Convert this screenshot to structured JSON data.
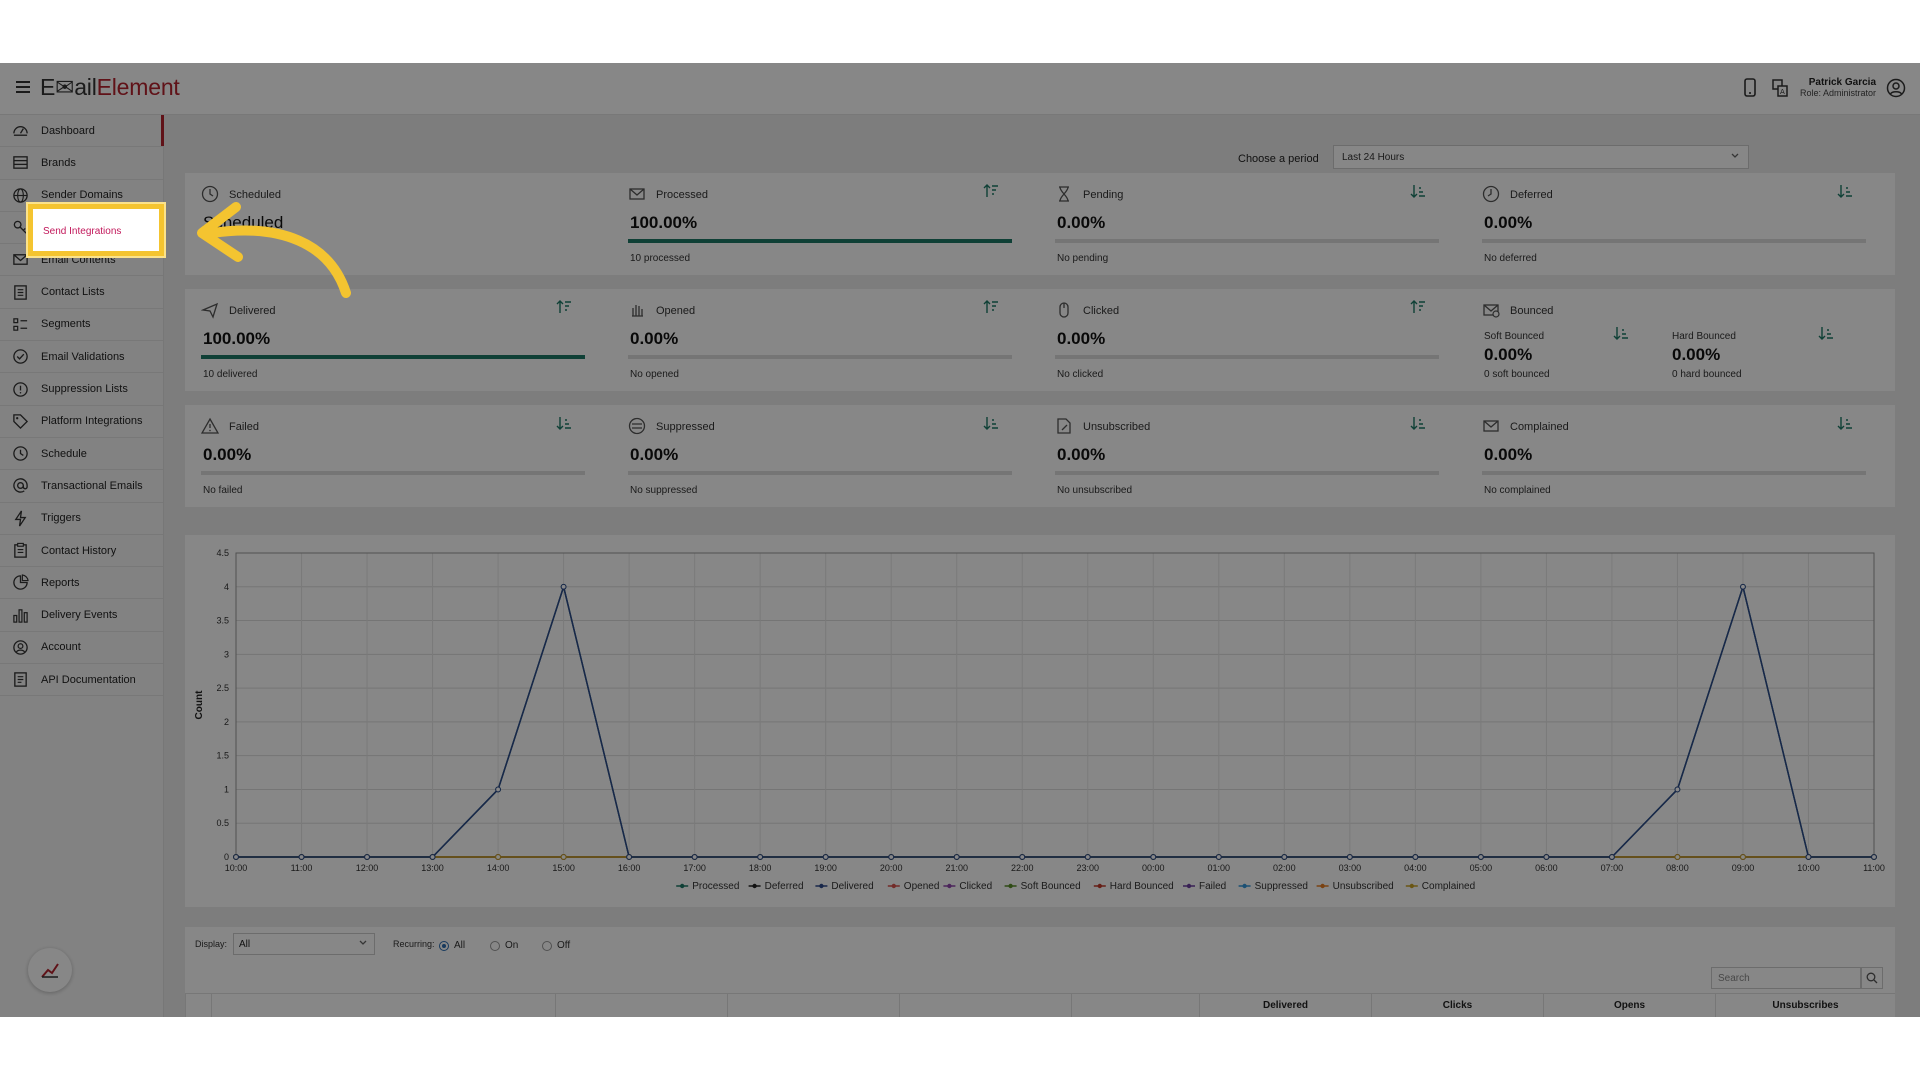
{
  "app": {
    "logo_left": "E✉ail",
    "logo_right": "Element",
    "user_name": "Patrick Garcia",
    "user_role": "Role: Administrator"
  },
  "sidebar": {
    "items": [
      {
        "label": "Dashboard",
        "icon": "dashboard-icon"
      },
      {
        "label": "Brands",
        "icon": "brands-icon"
      },
      {
        "label": "Sender Domains",
        "icon": "globe-icon"
      },
      {
        "label": "Send Integrations",
        "icon": "key-icon"
      },
      {
        "label": "Email Contents",
        "icon": "envelope-icon"
      },
      {
        "label": "Contact Lists",
        "icon": "list-icon"
      },
      {
        "label": "Segments",
        "icon": "segments-icon"
      },
      {
        "label": "Email Validations",
        "icon": "check-circle-icon"
      },
      {
        "label": "Suppression Lists",
        "icon": "alert-circle-icon"
      },
      {
        "label": "Platform Integrations",
        "icon": "tag-icon"
      },
      {
        "label": "Schedule",
        "icon": "clock-icon"
      },
      {
        "label": "Transactional Emails",
        "icon": "at-icon"
      },
      {
        "label": "Triggers",
        "icon": "lightning-icon"
      },
      {
        "label": "Contact History",
        "icon": "clipboard-icon"
      },
      {
        "label": "Reports",
        "icon": "pie-icon"
      },
      {
        "label": "Delivery Events",
        "icon": "bar-chart-icon"
      },
      {
        "label": "Account",
        "icon": "user-circle-icon"
      },
      {
        "label": "API Documentation",
        "icon": "document-icon"
      }
    ]
  },
  "period": {
    "label": "Choose a period",
    "value": "Last 24 Hours"
  },
  "stats": {
    "scheduled": {
      "title": "Scheduled",
      "value": "Scheduled"
    },
    "processed": {
      "title": "Processed",
      "value": "100.00%",
      "sub": "10 processed",
      "fill": 1.0
    },
    "pending": {
      "title": "Pending",
      "value": "0.00%",
      "sub": "No pending",
      "fill": 0
    },
    "deferred": {
      "title": "Deferred",
      "value": "0.00%",
      "sub": "No deferred",
      "fill": 0
    },
    "delivered": {
      "title": "Delivered",
      "value": "100.00%",
      "sub": "10 delivered",
      "fill": 1.0
    },
    "opened": {
      "title": "Opened",
      "value": "0.00%",
      "sub": "No opened",
      "fill": 0
    },
    "clicked": {
      "title": "Clicked",
      "value": "0.00%",
      "sub": "No clicked",
      "fill": 0
    },
    "bounced": {
      "title": "Bounced",
      "soft_title": "Soft Bounced",
      "soft_value": "0.00%",
      "soft_sub": "0 soft bounced",
      "hard_title": "Hard Bounced",
      "hard_value": "0.00%",
      "hard_sub": "0 hard bounced"
    },
    "failed": {
      "title": "Failed",
      "value": "0.00%",
      "sub": "No failed",
      "fill": 0
    },
    "suppressed": {
      "title": "Suppressed",
      "value": "0.00%",
      "sub": "No suppressed",
      "fill": 0
    },
    "unsubscribed": {
      "title": "Unsubscribed",
      "value": "0.00%",
      "sub": "No unsubscribed",
      "fill": 0
    },
    "complained": {
      "title": "Complained",
      "value": "0.00%",
      "sub": "No complained",
      "fill": 0
    }
  },
  "chart_data": {
    "type": "line",
    "x": [
      "10:00",
      "11:00",
      "12:00",
      "13:00",
      "14:00",
      "15:00",
      "16:00",
      "17:00",
      "18:00",
      "19:00",
      "20:00",
      "21:00",
      "22:00",
      "23:00",
      "00:00",
      "01:00",
      "02:00",
      "03:00",
      "04:00",
      "05:00",
      "06:00",
      "07:00",
      "08:00",
      "09:00",
      "10:00",
      "11:00"
    ],
    "ylabel": "Count",
    "xlabel": "",
    "ylim": [
      0,
      4.5
    ],
    "yticks": [
      "0",
      "0.5",
      "1",
      "1.5",
      "2",
      "2.5",
      "3",
      "3.5",
      "4",
      "4.5"
    ],
    "grid": true,
    "legend_position": "bottom",
    "series": [
      {
        "name": "Processed",
        "color": "#1d7a67",
        "values": [
          0,
          0,
          0,
          0,
          1,
          4,
          0,
          0,
          0,
          0,
          0,
          0,
          0,
          0,
          0,
          0,
          0,
          0,
          0,
          0,
          0,
          0,
          1,
          4,
          0,
          0
        ]
      },
      {
        "name": "Deferred",
        "color": "#222222",
        "values": [
          0,
          0,
          0,
          0,
          0,
          0,
          0,
          0,
          0,
          0,
          0,
          0,
          0,
          0,
          0,
          0,
          0,
          0,
          0,
          0,
          0,
          0,
          0,
          0,
          0,
          0
        ]
      },
      {
        "name": "Delivered",
        "color": "#2e4a8c",
        "values": [
          0,
          0,
          0,
          0,
          1,
          4,
          0,
          0,
          0,
          0,
          0,
          0,
          0,
          0,
          0,
          0,
          0,
          0,
          0,
          0,
          0,
          0,
          1,
          4,
          0,
          0
        ]
      },
      {
        "name": "Opened",
        "color": "#d9534f",
        "values": [
          0,
          0,
          0,
          0,
          0,
          0,
          0,
          0,
          0,
          0,
          0,
          0,
          0,
          0,
          0,
          0,
          0,
          0,
          0,
          0,
          0,
          0,
          0,
          0,
          0,
          0
        ]
      },
      {
        "name": "Clicked",
        "color": "#8e44ad",
        "values": [
          0,
          0,
          0,
          0,
          0,
          0,
          0,
          0,
          0,
          0,
          0,
          0,
          0,
          0,
          0,
          0,
          0,
          0,
          0,
          0,
          0,
          0,
          0,
          0,
          0,
          0
        ]
      },
      {
        "name": "Soft Bounced",
        "color": "#5a8f29",
        "values": [
          0,
          0,
          0,
          0,
          0,
          0,
          0,
          0,
          0,
          0,
          0,
          0,
          0,
          0,
          0,
          0,
          0,
          0,
          0,
          0,
          0,
          0,
          0,
          0,
          0,
          0
        ]
      },
      {
        "name": "Hard Bounced",
        "color": "#c0392b",
        "values": [
          0,
          0,
          0,
          0,
          0,
          0,
          0,
          0,
          0,
          0,
          0,
          0,
          0,
          0,
          0,
          0,
          0,
          0,
          0,
          0,
          0,
          0,
          0,
          0,
          0,
          0
        ]
      },
      {
        "name": "Failed",
        "color": "#6c3fa0",
        "values": [
          0,
          0,
          0,
          0,
          0,
          0,
          0,
          0,
          0,
          0,
          0,
          0,
          0,
          0,
          0,
          0,
          0,
          0,
          0,
          0,
          0,
          0,
          0,
          0,
          0,
          0
        ]
      },
      {
        "name": "Suppressed",
        "color": "#3498db",
        "values": [
          0,
          0,
          0,
          0,
          0,
          0,
          0,
          0,
          0,
          0,
          0,
          0,
          0,
          0,
          0,
          0,
          0,
          0,
          0,
          0,
          0,
          0,
          0,
          0,
          0,
          0
        ]
      },
      {
        "name": "Unsubscribed",
        "color": "#e67e22",
        "values": [
          0,
          0,
          0,
          0,
          0,
          0,
          0,
          0,
          0,
          0,
          0,
          0,
          0,
          0,
          0,
          0,
          0,
          0,
          0,
          0,
          0,
          0,
          0,
          0,
          0,
          0
        ]
      },
      {
        "name": "Complained",
        "color": "#c9a227",
        "values": [
          0,
          0,
          0,
          0,
          0,
          0,
          0,
          0,
          0,
          0,
          0,
          0,
          0,
          0,
          0,
          0,
          0,
          0,
          0,
          0,
          0,
          0,
          0,
          0,
          0,
          0
        ]
      }
    ]
  },
  "filters": {
    "display_label": "Display:",
    "display_value": "All",
    "recurring_label": "Recurring:",
    "options": [
      "All",
      "On",
      "Off"
    ],
    "selected": "All",
    "search_placeholder": "Search"
  },
  "table": {
    "columns": [
      "",
      "",
      "",
      "",
      "",
      "",
      "Delivered",
      "Clicks",
      "Opens",
      "Unsubscribes"
    ]
  },
  "overlay": {
    "highlight_label": "Send Integrations",
    "highlight_color": "#f4c430"
  }
}
